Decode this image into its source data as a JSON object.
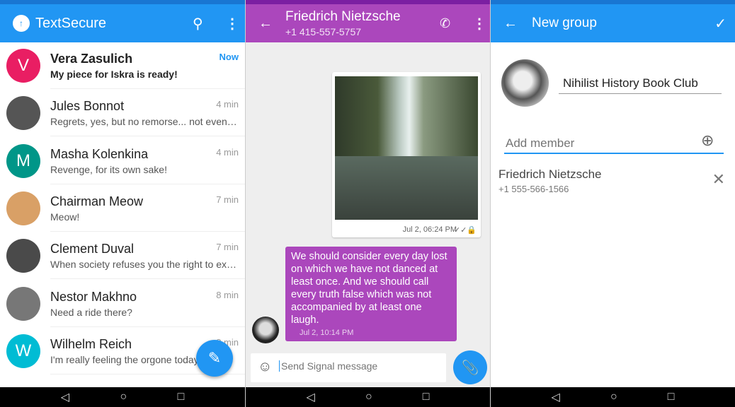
{
  "list": {
    "title": "TextSecure",
    "conversations": [
      {
        "name": "Vera Zasulich",
        "preview": "My piece for Iskra is ready!",
        "time": "Now",
        "initial": "V",
        "color": "#e91e63",
        "unread": true
      },
      {
        "name": "Jules Bonnot",
        "preview": "Regrets, yes, but no remorse... not even a gli...",
        "time": "4 min",
        "initial": "",
        "color": "#555555",
        "unread": false
      },
      {
        "name": "Masha Kolenkina",
        "preview": "Revenge, for its own sake!",
        "time": "4 min",
        "initial": "M",
        "color": "#009688",
        "unread": false
      },
      {
        "name": "Chairman Meow",
        "preview": "Meow!",
        "time": "7 min",
        "initial": "",
        "color": "#d9a066",
        "unread": false
      },
      {
        "name": "Clement Duval",
        "preview": "When society refuses you the right to exist,...",
        "time": "7 min",
        "initial": "",
        "color": "#4a4a4a",
        "unread": false
      },
      {
        "name": "Nestor Makhno",
        "preview": "Need a ride there?",
        "time": "8 min",
        "initial": "",
        "color": "#777777",
        "unread": false
      },
      {
        "name": "Wilhelm Reich",
        "preview": "I'm really feeling the orgone today!",
        "time": "8 min",
        "initial": "W",
        "color": "#00bcd4",
        "unread": false
      }
    ]
  },
  "chat": {
    "contact_name": "Friedrich Nietzsche",
    "contact_phone": "+1 415-557-5757",
    "image_time": "Jul 2, 06:24 PM",
    "message": "We should consider every day lost on which we have not danced at least once. And we should call every truth false which was not accompanied by at least one laugh.",
    "message_time": "Jul 2, 10:14 PM",
    "input_placeholder": "Send Signal message",
    "accent": "#ab47bc"
  },
  "group": {
    "title": "New group",
    "group_name": "Nihilist History Book Club",
    "add_member_placeholder": "Add member",
    "members": [
      {
        "name": "Friedrich Nietzsche",
        "phone": "+1 555-566-1566"
      }
    ]
  },
  "colors": {
    "primary": "#2196f3",
    "chat": "#ab47bc"
  }
}
